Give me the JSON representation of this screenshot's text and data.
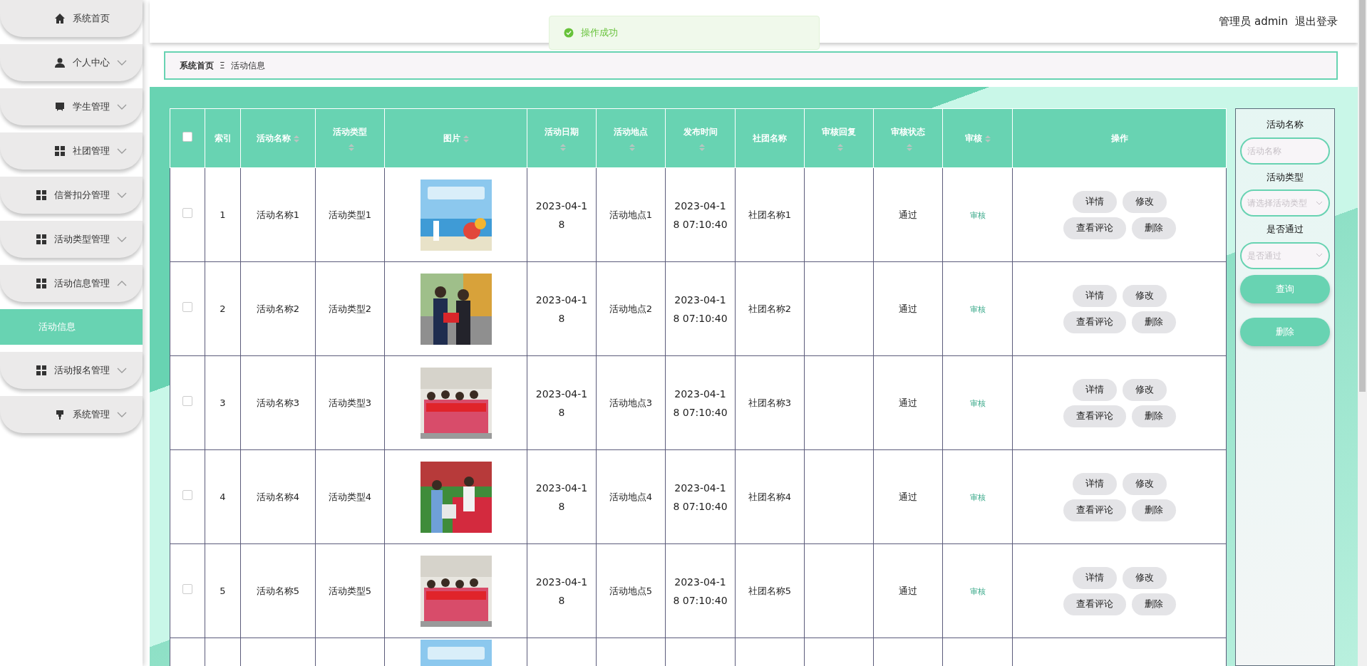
{
  "sidebar": {
    "items": [
      {
        "label": "系统首页",
        "expandable": false
      },
      {
        "label": "个人中心",
        "expandable": true,
        "expanded": false
      },
      {
        "label": "学生管理",
        "expandable": true,
        "expanded": false
      },
      {
        "label": "社团管理",
        "expandable": true,
        "expanded": false
      },
      {
        "label": "信誉扣分管理",
        "expandable": true,
        "expanded": false
      },
      {
        "label": "活动类型管理",
        "expandable": true,
        "expanded": false
      },
      {
        "label": "活动信息管理",
        "expandable": true,
        "expanded": true,
        "children": [
          {
            "label": "活动信息",
            "selected": true
          }
        ]
      },
      {
        "label": "活动报名管理",
        "expandable": true,
        "expanded": false
      },
      {
        "label": "系统管理",
        "expandable": true,
        "expanded": false
      }
    ]
  },
  "header": {
    "user": "管理员 admin",
    "logout": "退出登录"
  },
  "toast": {
    "kind": "success",
    "message": "操作成功"
  },
  "breadcrumb": [
    {
      "label": "系统首页",
      "current": false
    },
    {
      "label": "活动信息",
      "current": true
    }
  ],
  "breadcrumb_separator": "Ξ",
  "table": {
    "select_all": {
      "checked": false
    },
    "columns": [
      {
        "label": "索引",
        "sortable": false
      },
      {
        "label": "活动名称",
        "sortable": true
      },
      {
        "label": "活动类型",
        "sortable": true
      },
      {
        "label": "图片",
        "sortable": true
      },
      {
        "label": "活动日期",
        "sortable": true
      },
      {
        "label": "活动地点",
        "sortable": true
      },
      {
        "label": "发布时间",
        "sortable": true
      },
      {
        "label": "社团名称",
        "sortable": false
      },
      {
        "label": "审核回复",
        "sortable": true
      },
      {
        "label": "审核状态",
        "sortable": true
      },
      {
        "label": "审核",
        "sortable": true
      },
      {
        "label": "操作",
        "sortable": false
      }
    ],
    "rows": [
      {
        "checked": false,
        "index": "1",
        "name": "活动名称1",
        "type": "活动类型1",
        "date": "2023-04-18",
        "place": "活动地点1",
        "time": "2023-04-18 07:10:40",
        "club": "社团名称1",
        "status": "通过",
        "audit": "审核",
        "actions": [
          "详情",
          "修改",
          "查看评论",
          "删除"
        ]
      },
      {
        "checked": false,
        "index": "2",
        "name": "活动名称2",
        "type": "活动类型2",
        "date": "2023-04-18",
        "place": "活动地点2",
        "time": "2023-04-18 07:10:40",
        "club": "社团名称2",
        "status": "通过",
        "audit": "审核",
        "actions": [
          "详情",
          "修改",
          "查看评论",
          "删除"
        ]
      },
      {
        "checked": false,
        "index": "3",
        "name": "活动名称3",
        "type": "活动类型3",
        "date": "2023-04-18",
        "place": "活动地点3",
        "time": "2023-04-18 07:10:40",
        "club": "社团名称3",
        "status": "通过",
        "audit": "审核",
        "actions": [
          "详情",
          "修改",
          "查看评论",
          "删除"
        ]
      },
      {
        "checked": false,
        "index": "4",
        "name": "活动名称4",
        "type": "活动类型4",
        "date": "2023-04-18",
        "place": "活动地点4",
        "time": "2023-04-18 07:10:40",
        "club": "社团名称4",
        "status": "通过",
        "audit": "审核",
        "actions": [
          "详情",
          "修改",
          "查看评论",
          "删除"
        ]
      },
      {
        "checked": false,
        "index": "5",
        "name": "活动名称5",
        "type": "活动类型5",
        "date": "2023-04-18",
        "place": "活动地点5",
        "time": "2023-04-18 07:10:40",
        "club": "社团名称5",
        "status": "通过",
        "audit": "审核",
        "actions": [
          "详情",
          "修改",
          "查看评论",
          "删除"
        ]
      },
      {
        "partial": true
      }
    ]
  },
  "search": {
    "fields": [
      {
        "kind": "input",
        "label": "活动名称",
        "placeholder": "活动名称"
      },
      {
        "kind": "select",
        "label": "活动类型",
        "placeholder": "请选择活动类型"
      },
      {
        "kind": "select",
        "label": "是否通过",
        "placeholder": "是否通过"
      }
    ],
    "buttons": [
      "查询",
      "删除"
    ]
  }
}
